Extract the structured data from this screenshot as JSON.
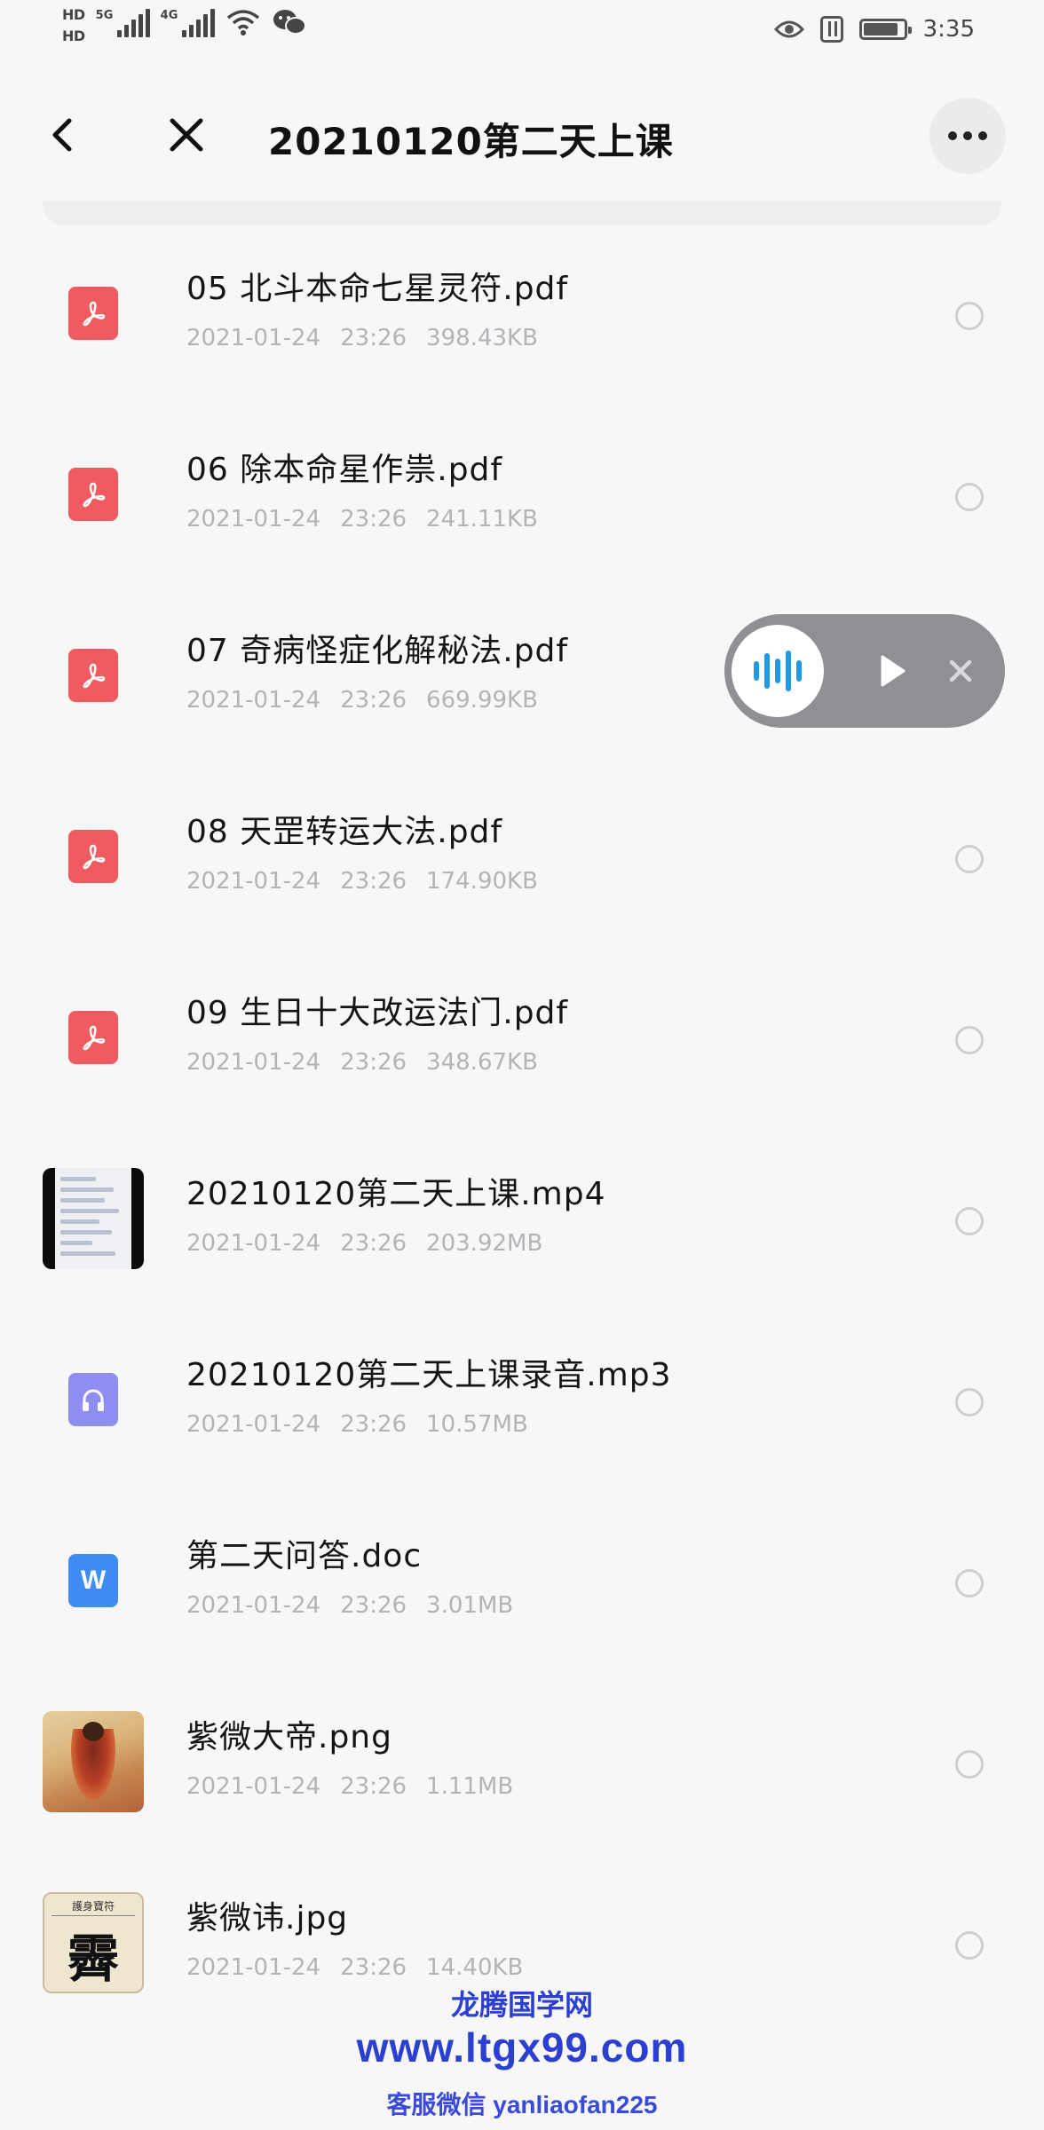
{
  "status_bar": {
    "hd1": "HD",
    "hd2": "HD",
    "sig1_label": "5G",
    "sig2_label": "4G",
    "time": "3:35"
  },
  "nav": {
    "title": "20210120第二天上课",
    "back_icon": "chevron-left-icon",
    "close_icon": "close-icon",
    "more_icon": "more-dots-icon"
  },
  "files": [
    {
      "name": "05 北斗本命七星灵符.pdf",
      "date": "2021-01-24",
      "time": "23:26",
      "size": "398.43KB",
      "type": "pdf"
    },
    {
      "name": "06 除本命星作祟.pdf",
      "date": "2021-01-24",
      "time": "23:26",
      "size": "241.11KB",
      "type": "pdf"
    },
    {
      "name": "07 奇病怪症化解秘法.pdf",
      "date": "2021-01-24",
      "time": "23:26",
      "size": "669.99KB",
      "type": "pdf"
    },
    {
      "name": "08 天罡转运大法.pdf",
      "date": "2021-01-24",
      "time": "23:26",
      "size": "174.90KB",
      "type": "pdf"
    },
    {
      "name": "09 生日十大改运法门.pdf",
      "date": "2021-01-24",
      "time": "23:26",
      "size": "348.67KB",
      "type": "pdf"
    },
    {
      "name": "20210120第二天上课.mp4",
      "date": "2021-01-24",
      "time": "23:26",
      "size": "203.92MB",
      "type": "video"
    },
    {
      "name": "20210120第二天上课录音.mp3",
      "date": "2021-01-24",
      "time": "23:26",
      "size": "10.57MB",
      "type": "audio"
    },
    {
      "name": "第二天问答.doc",
      "date": "2021-01-24",
      "time": "23:26",
      "size": "3.01MB",
      "type": "doc"
    },
    {
      "name": "紫微大帝.png",
      "date": "2021-01-24",
      "time": "23:26",
      "size": "1.11MB",
      "type": "image"
    },
    {
      "name": "紫微讳.jpg",
      "date": "2021-01-24",
      "time": "23:26",
      "size": "14.40KB",
      "type": "talisman"
    }
  ],
  "thumbnails": {
    "word_letter": "W",
    "talisman_header": "護身寶符",
    "talisman_char": "霽"
  },
  "voice_widget": {
    "wave_icon": "voice-wave-icon",
    "play_icon": "play-icon",
    "close_icon": "close-icon"
  },
  "watermark": {
    "line1": "龙腾国学网",
    "line2": "www.ltgx99.com",
    "line3": "客服微信 yanliaofan225"
  },
  "colors": {
    "pdf": "#ef5b60",
    "audio": "#8f8df0",
    "doc": "#3f8cf2",
    "voice_accent": "#1f9ae0",
    "watermark": "#2b3fd1"
  }
}
